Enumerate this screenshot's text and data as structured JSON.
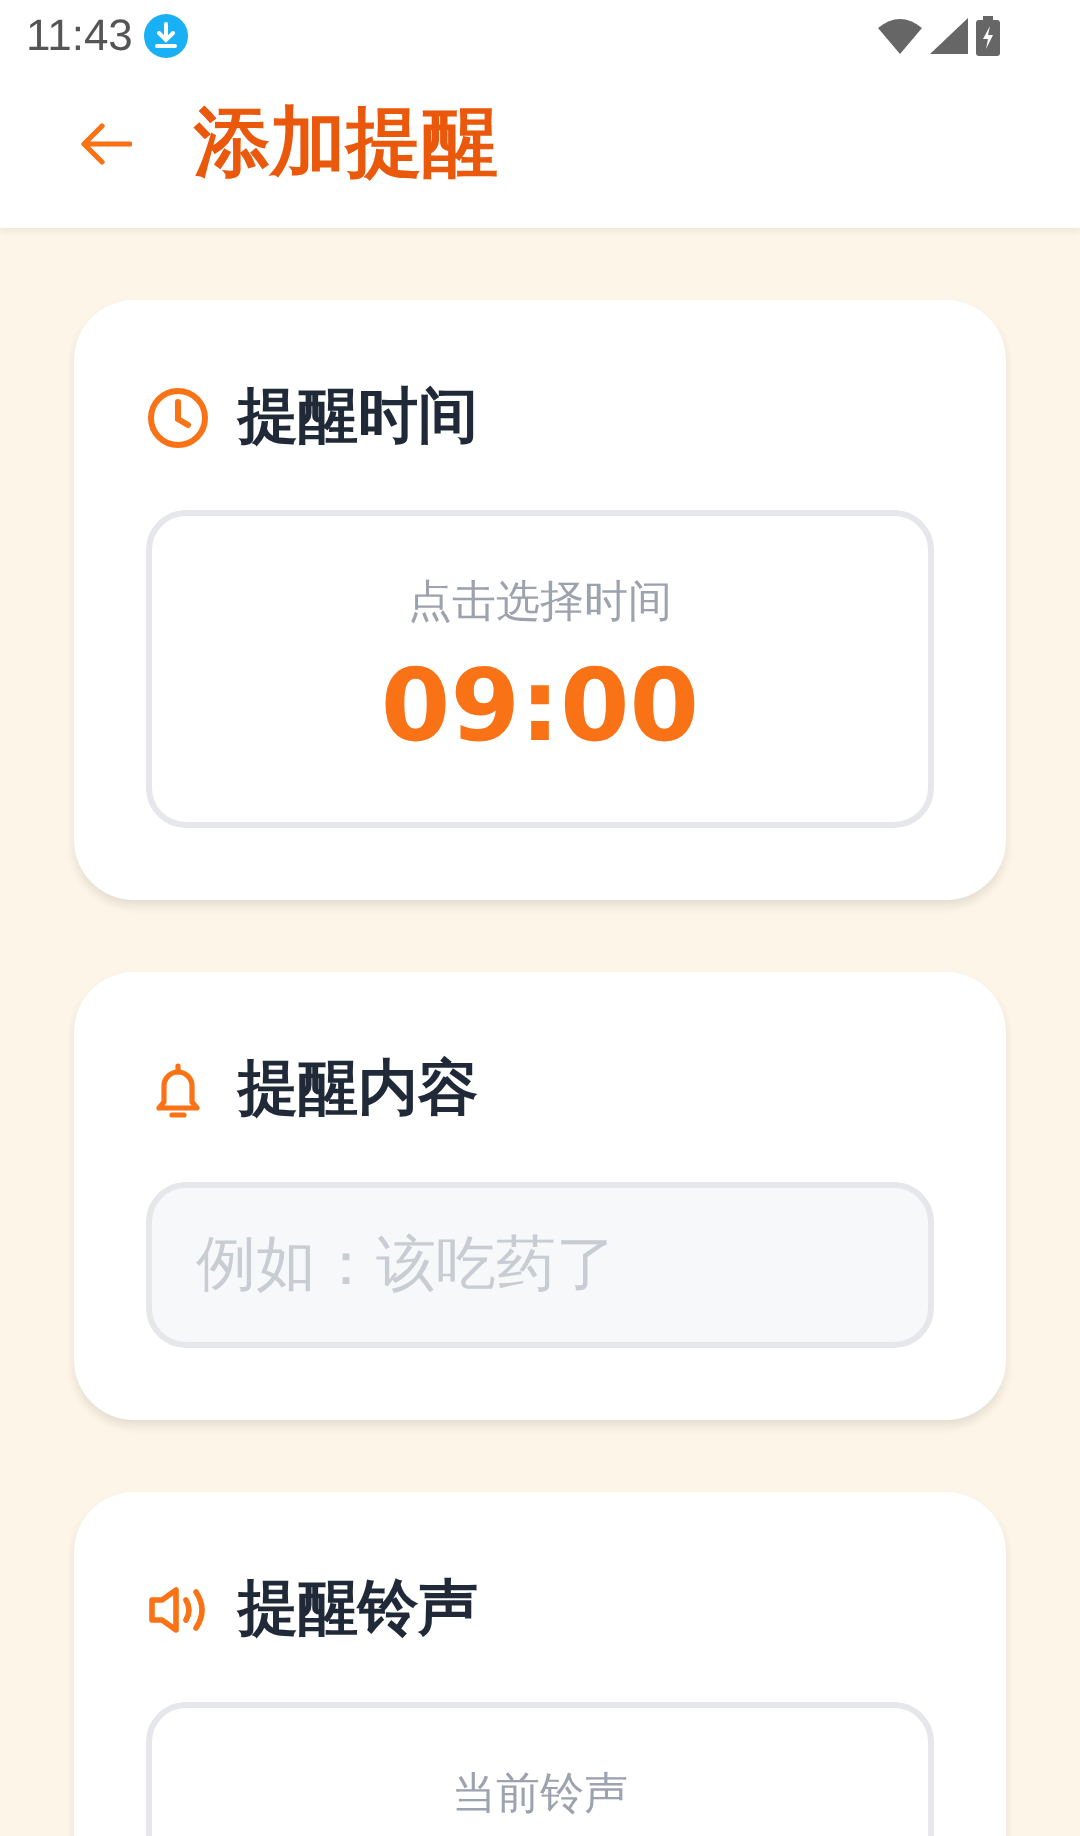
{
  "status_bar": {
    "time": "11:43"
  },
  "header": {
    "title": "添加提醒"
  },
  "sections": [
    {
      "kind": "time",
      "title": "提醒时间",
      "hint": "点击选择时间",
      "value": "09:00"
    },
    {
      "kind": "text",
      "title": "提醒内容",
      "placeholder": "例如：该吃药了"
    },
    {
      "kind": "ringtone",
      "title": "提醒铃声",
      "label": "当前铃声"
    }
  ]
}
